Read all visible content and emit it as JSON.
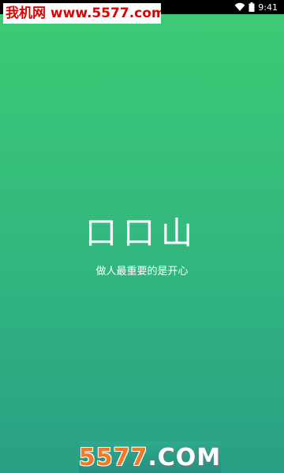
{
  "status_bar": {
    "time": "9:41",
    "icons": [
      "wifi-icon",
      "battery-icon"
    ]
  },
  "watermark_top": {
    "text": "我机网 www.5577.com",
    "color": "#e00000"
  },
  "splash": {
    "title": "口口山",
    "slogan": "做人最重要的是开心"
  },
  "watermark_bottom": {
    "number": "5577",
    "domain": ".COM",
    "number_color": "#f07a26"
  },
  "colors": {
    "gradient_top": "#3ecb74",
    "gradient_bottom": "#28a085"
  }
}
